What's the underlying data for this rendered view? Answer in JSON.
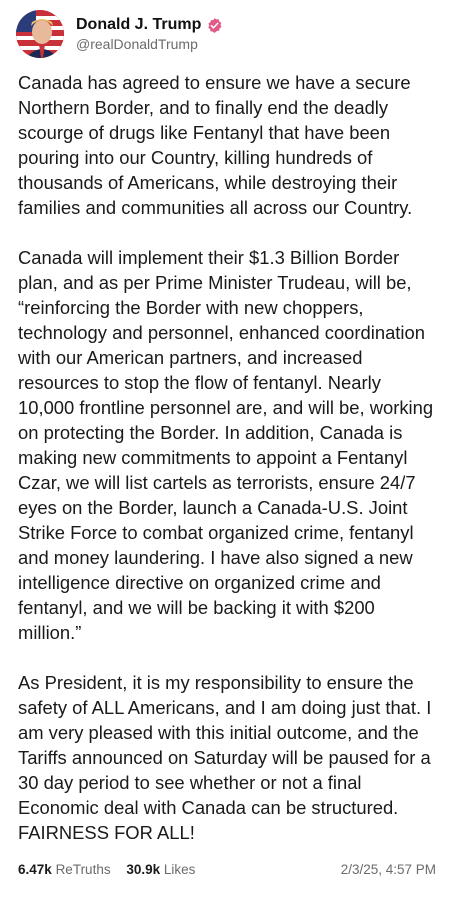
{
  "author": {
    "display_name": "Donald J. Trump",
    "handle": "@realDonaldTrump",
    "verified_color": "#e05a8a"
  },
  "post": {
    "paragraphs": [
      "Canada has agreed to ensure we have a secure Northern Border, and to finally end the deadly scourge of drugs like Fentanyl that have been pouring into our Country, killing hundreds of thousands of Americans, while destroying their families and communities all across our Country.",
      "Canada will implement their $1.3 Billion Border plan, and as per Prime Minister Trudeau, will be, “reinforcing the Border with new choppers, technology and personnel, enhanced coordination with our American partners, and increased resources to stop the flow of fentanyl. Nearly 10,000 frontline personnel are, and will be, working on protecting the Border. In addition, Canada is making new commitments to appoint a Fentanyl Czar, we will list cartels as terrorists, ensure 24/7 eyes on the Border, launch a Canada-U.S. Joint Strike Force to combat organized crime, fentanyl and money laundering. I have also signed a new intelligence directive on organized crime and fentanyl, and we will be backing it with $200 million.”",
      "As President, it is my responsibility to ensure the safety of ALL Americans, and I am doing just that. I am very pleased with this initial outcome, and the Tariffs announced on Saturday will be paused for a 30 day period to see whether or not a final Economic deal with Canada can be structured. FAIRNESS FOR ALL!"
    ]
  },
  "stats": {
    "retruths_count": "6.47k",
    "retruths_label": "ReTruths",
    "likes_count": "30.9k",
    "likes_label": "Likes",
    "timestamp": "2/3/25, 4:57 PM"
  }
}
